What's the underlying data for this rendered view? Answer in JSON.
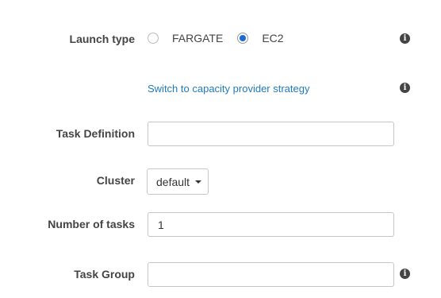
{
  "launch_type": {
    "label": "Launch type",
    "options": [
      {
        "label": "FARGATE",
        "selected": false
      },
      {
        "label": "EC2",
        "selected": true
      }
    ],
    "info_icon": "info-icon"
  },
  "capacity_link": {
    "label": "Switch to capacity provider strategy",
    "info_icon": "info-icon"
  },
  "task_definition": {
    "label": "Task Definition",
    "value": ""
  },
  "cluster": {
    "label": "Cluster",
    "selected": "default"
  },
  "number_of_tasks": {
    "label": "Number of tasks",
    "value": "1"
  },
  "task_group": {
    "label": "Task Group",
    "value": "",
    "info_icon": "info-icon"
  },
  "colors": {
    "link": "#1f7bc1",
    "radio_selected": "#1f6bd6"
  }
}
